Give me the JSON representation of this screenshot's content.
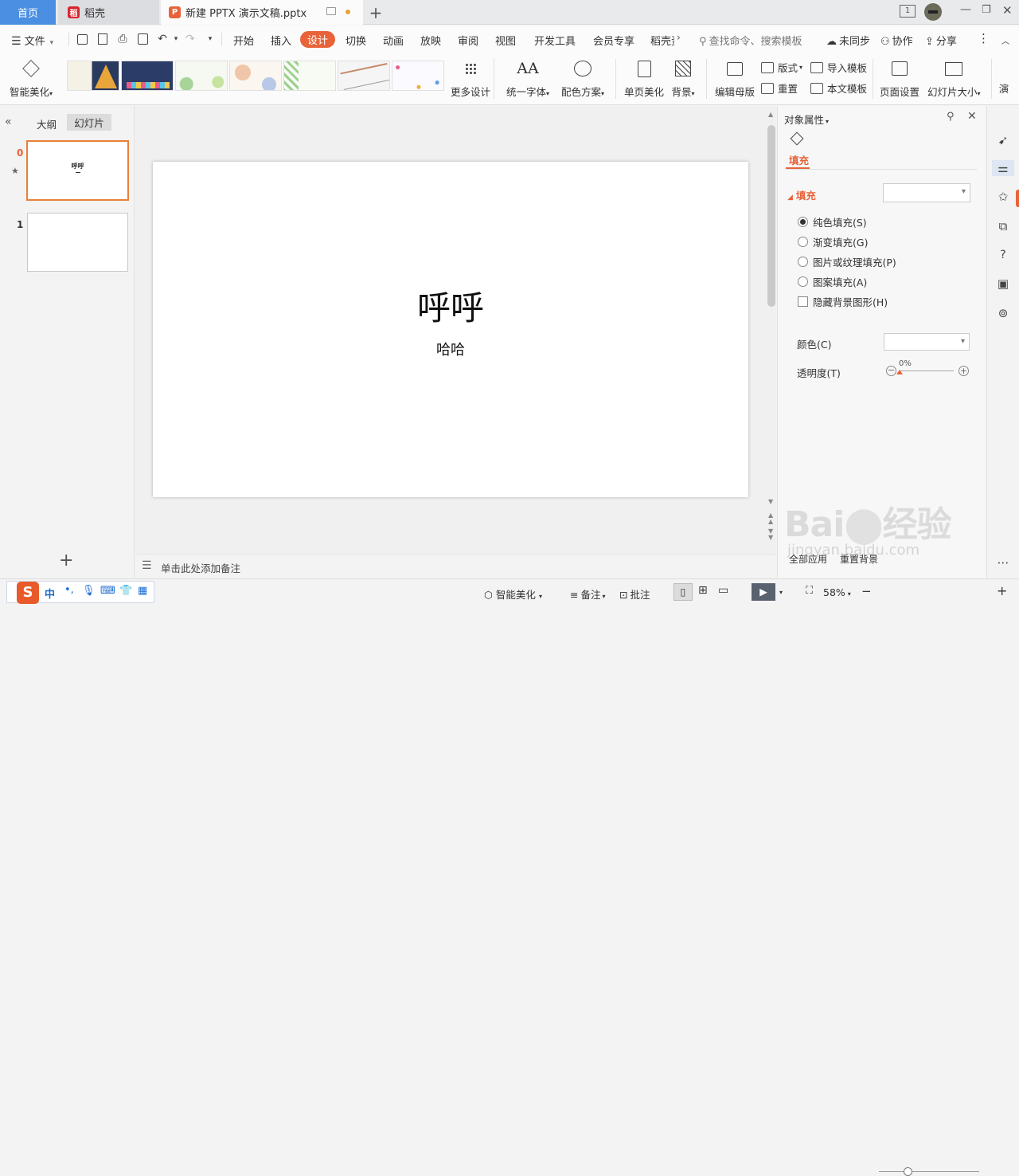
{
  "tabs": {
    "home": "首页",
    "daoke": "稻壳",
    "doc": "新建 PPTX 演示文稿.pptx",
    "new_tab": "+"
  },
  "window": {
    "badge": "1"
  },
  "menu": {
    "file": "文件",
    "items": [
      "开始",
      "插入",
      "设计",
      "切换",
      "动画",
      "放映",
      "审阅",
      "视图",
      "开发工具",
      "会员专享",
      "稻壳资"
    ],
    "search_placeholder": "查找命令、搜索模板",
    "unsynced": "未同步",
    "collab": "协作",
    "share": "分享"
  },
  "ribbon": {
    "smart_beautify": "智能美化",
    "more_design": "更多设计",
    "unify_font": "统一字体",
    "color_scheme": "配色方案",
    "single_page_beautify": "单页美化",
    "background": "背景",
    "edit_master": "编辑母版",
    "layout": "版式",
    "reset": "重置",
    "import_template": "导入模板",
    "text_template": "本文模板",
    "page_setup": "页面设置",
    "slide_size": "幻灯片大小",
    "overflow": "演"
  },
  "left_panel": {
    "outline_tab": "大纲",
    "slides_tab": "幻灯片",
    "slides": [
      {
        "number": "0",
        "title": "呼呼"
      },
      {
        "number": "1",
        "title": ""
      }
    ],
    "add_slide": "+"
  },
  "slide": {
    "title": "呼呼",
    "subtitle": "哈哈"
  },
  "notes": {
    "placeholder": "单击此处添加备注"
  },
  "properties": {
    "header": "对象属性",
    "tab_fill": "填充",
    "section_fill": "填充",
    "options": [
      {
        "label": "纯色填充(S)",
        "checked": true
      },
      {
        "label": "渐变填充(G)",
        "checked": false
      },
      {
        "label": "图片或纹理填充(P)",
        "checked": false
      },
      {
        "label": "图案填充(A)",
        "checked": false
      }
    ],
    "hide_bg_graphics": "隐藏背景图形(H)",
    "color_label": "颜色(C)",
    "transparency_label": "透明度(T)",
    "transparency_value": "0%",
    "apply_all": "全部应用",
    "reset_bg": "重置背景"
  },
  "status": {
    "ime": "中",
    "smart_beautify": "智能美化",
    "notes": "备注",
    "comments": "批注",
    "zoom": "58%",
    "zoom_fraction": 0.58
  },
  "watermark": {
    "brand": "Baidu经验",
    "url": "jingyan.baidu.com"
  },
  "colors": {
    "accent": "#e8633a",
    "home_tab": "#4a8fe2"
  }
}
